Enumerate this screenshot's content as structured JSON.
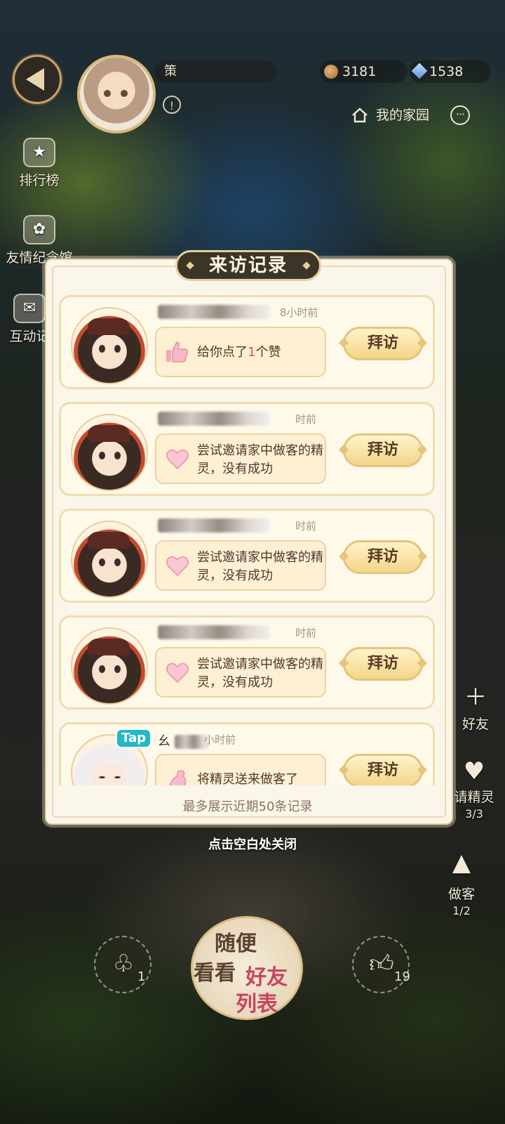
{
  "header": {
    "player_name": "策",
    "coins": "3181",
    "gems": "1538",
    "home_label": "我的家园"
  },
  "left_menu": [
    {
      "label": "排行榜"
    },
    {
      "label": "友情纪念馆"
    },
    {
      "label": "互动记"
    }
  ],
  "right_menu": {
    "add_friend": "好友",
    "invite_spirit": "请精灵",
    "invite_count": "3/3",
    "guest": "做客",
    "guest_count": "1/2"
  },
  "modal": {
    "title": "来访记录",
    "footer": "最多展示近期50条记录",
    "close_hint": "点击空白处关闭",
    "visit_label": "拜访",
    "records": [
      {
        "time": "8小时前",
        "message_prefix": "给你点了",
        "message_highlight": "1",
        "message_suffix": "个赞",
        "icon": "thumbs-up-icon"
      },
      {
        "time": "时前",
        "message_prefix": "尝试邀请家中做客的精灵，没有成功",
        "message_highlight": "",
        "message_suffix": "",
        "icon": "heart-icon"
      },
      {
        "time": "时前",
        "message_prefix": "尝试邀请家中做客的精灵，没有成功",
        "message_highlight": "",
        "message_suffix": "",
        "icon": "heart-icon"
      },
      {
        "time": "时前",
        "message_prefix": "尝试邀请家中做客的精灵，没有成功",
        "message_highlight": "",
        "message_suffix": "",
        "icon": "heart-icon"
      },
      {
        "time": "小时前",
        "message_prefix": "将精灵送来做客了",
        "message_highlight": "",
        "message_suffix": "",
        "icon": "spirit-icon",
        "badge": "Tap",
        "name_prefix": "幺"
      }
    ]
  },
  "bottom": {
    "left_count": "1",
    "right_count": "19",
    "random_line1": "随便",
    "random_line2": "看看",
    "friends_line1": "好友",
    "friends_line2": "列表"
  },
  "colors": {
    "modal_bg": "#fbf6ea",
    "title_bg": "#3b3528",
    "gold_border": "#e5c47b",
    "highlight": "#e54e5f"
  }
}
